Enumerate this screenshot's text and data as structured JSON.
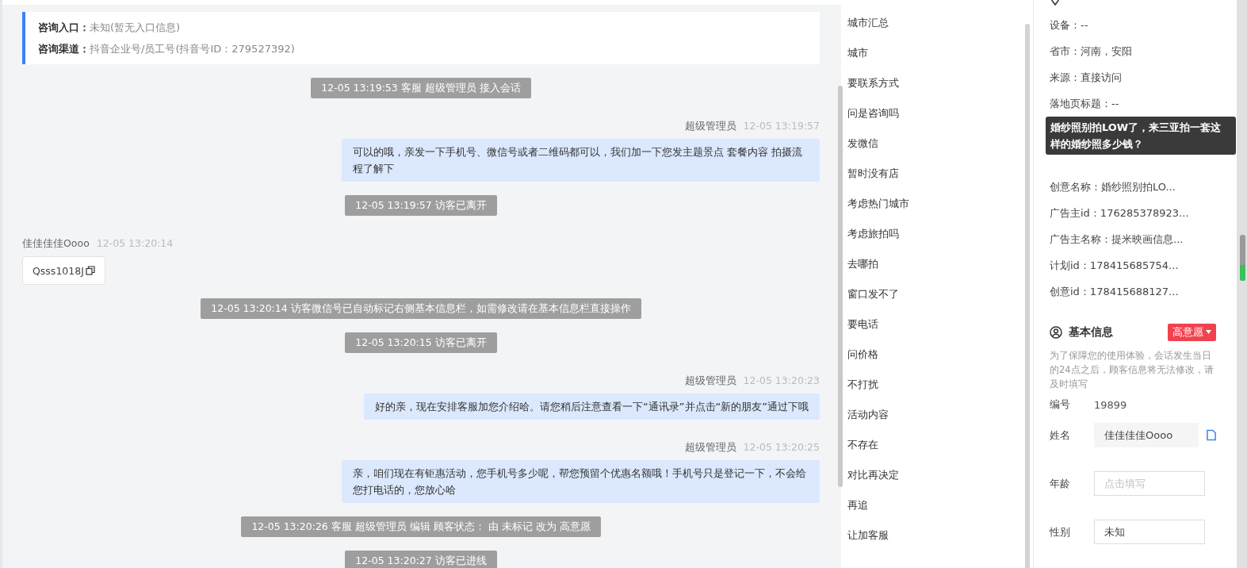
{
  "consult_info": [
    {
      "label": "咨询入口：",
      "value": "未知(暂无入口信息)"
    },
    {
      "label": "咨询渠道：",
      "value": "抖音企业号/员工号(抖音号ID：279527392)"
    }
  ],
  "messages": [
    {
      "kind": "system",
      "text": "12-05 13:19:53 客服 超级管理员 接入会话"
    },
    {
      "kind": "agent",
      "sender": "超级管理员",
      "time": "12-05 13:19:57",
      "text": "可以的哦，亲发一下手机号、微信号或者二维码都可以，我们加一下您发主题景点 套餐内容 拍摄流程了解下"
    },
    {
      "kind": "system",
      "text": "12-05 13:19:57 访客已离开"
    },
    {
      "kind": "visitor",
      "sender": "佳佳佳佳Oooo",
      "time": "12-05 13:20:14",
      "text": "Qsss1018J"
    },
    {
      "kind": "system",
      "text": "12-05 13:20:14 访客微信号已自动标记右侧基本信息栏，如需修改请在基本信息栏直接操作"
    },
    {
      "kind": "system",
      "text": "12-05 13:20:15 访客已离开"
    },
    {
      "kind": "agent",
      "sender": "超级管理员",
      "time": "12-05 13:20:23",
      "text": "好的亲，现在安排客服加您介绍哈。请您稍后注意查看一下“通讯录”并点击“新的朋友”通过下哦"
    },
    {
      "kind": "agent",
      "sender": "超级管理员",
      "time": "12-05 13:20:25",
      "text": "亲，咱们现在有钜惠活动，您手机号多少呢，帮您预留个优惠名额哦！手机号只是登记一下，不会给您打电话的，您放心哈"
    },
    {
      "kind": "system",
      "text": "12-05 13:20:26 客服 超级管理员 编辑 顾客状态： 由 未标记 改为 高意愿"
    },
    {
      "kind": "system",
      "text": "12-05 13:20:27 访客已进线"
    }
  ],
  "quick_replies": [
    "城市汇总",
    "城市",
    "要联系方式",
    "问是咨询吗",
    "发微信",
    "暂时没有店",
    "考虑热门城市",
    "考虑旅拍吗",
    "去哪拍",
    "窗口发不了",
    "要电话",
    "问价格",
    "不打扰",
    "活动内容",
    "不存在",
    "对比再决定",
    "再追",
    "让加客服"
  ],
  "source_info": {
    "rows": [
      "设备：--",
      "省市：河南，安阳",
      "来源：直接访问",
      "落地页标题：--",
      "创意名称：婚纱照别拍LO...",
      "广告主id：176285378923...",
      "广告主名称：提米映画信息...",
      "计划id：178415685754...",
      "创意id：178415688127..."
    ],
    "tooltip": "婚纱照别拍LOW了，来三亚拍一套这样的婚纱照多少钱？"
  },
  "basic_info": {
    "title": "基本信息",
    "status": "高意愿",
    "notice": "为了保障您的使用体验，会话发生当日的24点之后，顾客信息将无法修改，请及时填写",
    "fields": [
      {
        "kind": "text",
        "label": "编号",
        "value": "19899"
      },
      {
        "kind": "readonly",
        "label": "姓名",
        "value": "佳佳佳佳Oooo"
      },
      {
        "kind": "input",
        "label": "年龄",
        "placeholder": "点击填写"
      },
      {
        "kind": "input",
        "label": "性别",
        "value": "未知"
      }
    ]
  }
}
